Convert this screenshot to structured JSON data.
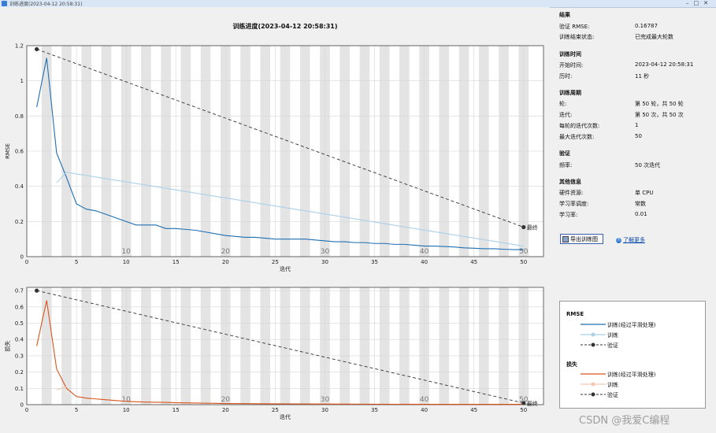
{
  "window": {
    "title": "训练进度(2023-04-12 20:58:31)"
  },
  "chart_data": [
    {
      "type": "line",
      "title": "训练进度(2023-04-12 20:58:31)",
      "xlabel": "迭代",
      "ylabel": "RMSE",
      "xlim": [
        0,
        52
      ],
      "ylim": [
        0,
        1.2
      ],
      "xticks": [
        0,
        5,
        10,
        15,
        20,
        25,
        30,
        35,
        40,
        45,
        50
      ],
      "yticks": [
        0,
        0.2,
        0.4,
        0.6,
        0.8,
        1.0,
        1.2
      ],
      "ytick_labels": [
        "0",
        "0.2",
        "0.4",
        "0.6",
        "0.8",
        "1",
        "1.2"
      ],
      "epoch_labels": [
        {
          "x": 10,
          "label": "10"
        },
        {
          "x": 20,
          "label": "20"
        },
        {
          "x": 30,
          "label": "30"
        },
        {
          "x": 40,
          "label": "40"
        },
        {
          "x": 50,
          "label": "50"
        }
      ],
      "series": [
        {
          "name": "训练(经过平滑处理)",
          "color": "#1f6fb4",
          "x": [
            1,
            2,
            3,
            4,
            5,
            6,
            7,
            8,
            9,
            10,
            11,
            12,
            13,
            14,
            15,
            16,
            17,
            18,
            19,
            20,
            21,
            22,
            23,
            24,
            25,
            26,
            27,
            28,
            29,
            30,
            31,
            32,
            33,
            34,
            35,
            36,
            37,
            38,
            39,
            40,
            41,
            42,
            43,
            44,
            45,
            46,
            47,
            48,
            49,
            50
          ],
          "y": [
            0.85,
            1.13,
            0.59,
            0.45,
            0.3,
            0.27,
            0.26,
            0.24,
            0.22,
            0.2,
            0.18,
            0.18,
            0.18,
            0.16,
            0.16,
            0.155,
            0.15,
            0.14,
            0.13,
            0.12,
            0.115,
            0.11,
            0.11,
            0.105,
            0.1,
            0.1,
            0.1,
            0.1,
            0.095,
            0.09,
            0.085,
            0.085,
            0.08,
            0.08,
            0.075,
            0.075,
            0.07,
            0.07,
            0.065,
            0.06,
            0.06,
            0.058,
            0.055,
            0.05,
            0.048,
            0.045,
            0.045,
            0.042,
            0.04,
            0.04
          ]
        },
        {
          "name": "训练",
          "color": "#a9d0ea",
          "x": [
            3,
            4,
            50
          ],
          "y": [
            0.42,
            0.48,
            0.06
          ]
        },
        {
          "name": "验证",
          "color": "#333333",
          "dashed": true,
          "x": [
            1,
            50
          ],
          "y": [
            1.18,
            0.16787
          ]
        }
      ],
      "final_label": "最终"
    },
    {
      "type": "line",
      "xlabel": "迭代",
      "ylabel": "损失",
      "xlim": [
        0,
        52
      ],
      "ylim": [
        0,
        0.72
      ],
      "xticks": [
        0,
        5,
        10,
        15,
        20,
        25,
        30,
        35,
        40,
        45,
        50
      ],
      "yticks": [
        0,
        0.1,
        0.2,
        0.3,
        0.4,
        0.5,
        0.6,
        0.7
      ],
      "ytick_labels": [
        "0",
        "0.1",
        "0.2",
        "0.3",
        "0.4",
        "0.5",
        "0.6",
        "0.7"
      ],
      "epoch_labels": [
        {
          "x": 10,
          "label": "10"
        },
        {
          "x": 20,
          "label": "20"
        },
        {
          "x": 30,
          "label": "30"
        },
        {
          "x": 40,
          "label": "40"
        },
        {
          "x": 50,
          "label": "50"
        }
      ],
      "series": [
        {
          "name": "训练(经过平滑处理)",
          "color": "#d95319",
          "x": [
            1,
            2,
            3,
            4,
            5,
            6,
            7,
            8,
            9,
            10,
            11,
            12,
            13,
            14,
            15,
            16,
            17,
            18,
            19,
            20,
            25,
            30,
            35,
            40,
            45,
            50
          ],
          "y": [
            0.36,
            0.64,
            0.22,
            0.1,
            0.05,
            0.04,
            0.035,
            0.03,
            0.025,
            0.02,
            0.018,
            0.016,
            0.015,
            0.014,
            0.012,
            0.011,
            0.01,
            0.009,
            0.008,
            0.007,
            0.005,
            0.004,
            0.003,
            0.002,
            0.002,
            0.002
          ]
        },
        {
          "name": "训练",
          "color": "#f4c8ad",
          "x": [
            3,
            4
          ],
          "y": [
            0.09,
            0.11
          ]
        },
        {
          "name": "验证",
          "color": "#333333",
          "dashed": true,
          "x": [
            1,
            50
          ],
          "y": [
            0.7,
            0.01
          ]
        }
      ],
      "final_label": "最终"
    }
  ],
  "info": {
    "results": {
      "title": "结果",
      "rows": [
        {
          "label": "验证 RMSE:",
          "value": "0.16787"
        },
        {
          "label": "训练结束状态:",
          "value": "已完成最大轮数"
        }
      ]
    },
    "time": {
      "title": "训练时间",
      "rows": [
        {
          "label": "开始时间:",
          "value": "2023-04-12 20:58:31"
        },
        {
          "label": "历时:",
          "value": "11 秒"
        }
      ]
    },
    "cycle": {
      "title": "训练周期",
      "rows": [
        {
          "label": "轮:",
          "value": "第 50 轮，共 50 轮"
        },
        {
          "label": "迭代:",
          "value": "第 50 次，共 50 次"
        },
        {
          "label": "每轮的迭代次数:",
          "value": "1"
        },
        {
          "label": "最大迭代次数:",
          "value": "50"
        }
      ]
    },
    "validation": {
      "title": "验证",
      "rows": [
        {
          "label": "频率:",
          "value": "50 次迭代"
        }
      ]
    },
    "other": {
      "title": "其他信息",
      "rows": [
        {
          "label": "硬件资源:",
          "value": "单 CPU"
        },
        {
          "label": "学习率调度:",
          "value": "常数"
        },
        {
          "label": "学习率:",
          "value": "0.01"
        }
      ]
    }
  },
  "buttons": {
    "export_label": "导出训练图",
    "learn_more_label": "了解更多"
  },
  "legend": {
    "rmse_title": "RMSE",
    "loss_title": "损失",
    "items_rmse": [
      {
        "label": "训练(经过平滑处理)",
        "color": "#1f6fb4",
        "style": "line"
      },
      {
        "label": "训练",
        "color": "#a9d0ea",
        "style": "line-dot"
      },
      {
        "label": "验证",
        "color": "#333333",
        "style": "dash-dot"
      }
    ],
    "items_loss": [
      {
        "label": "训练(经过平滑处理)",
        "color": "#d95319",
        "style": "line"
      },
      {
        "label": "训练",
        "color": "#f4c8ad",
        "style": "line-dot"
      },
      {
        "label": "验证",
        "color": "#333333",
        "style": "dash-dot"
      }
    ]
  },
  "watermark": "CSDN @我爱C编程"
}
